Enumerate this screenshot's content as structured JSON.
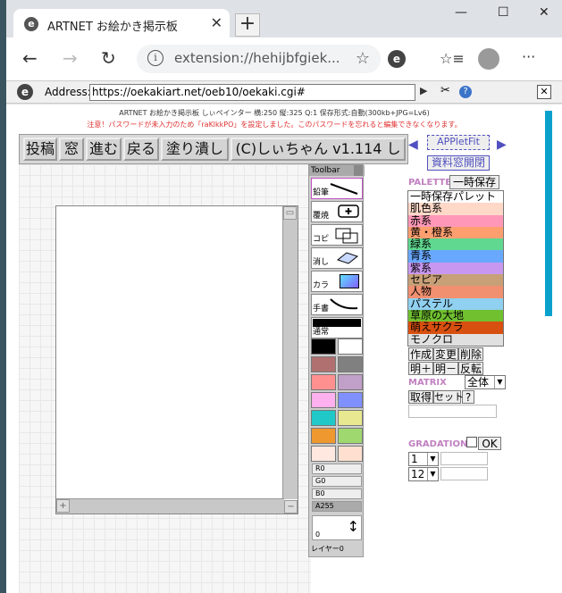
{
  "browser": {
    "tab_title": "ARTNET お絵かき掲示板",
    "tab_close": "✕",
    "new_tab": "+",
    "omnibox_url": "extension://hehijbfgiek...",
    "window_controls": {
      "minimize": "—",
      "maximize": "☐",
      "close": "✕"
    },
    "nav": {
      "back": "←",
      "forward": "→",
      "reload": "↻",
      "collections": "☆≡",
      "menu": "···"
    }
  },
  "ie_bar": {
    "label": "Address:",
    "url": "https://oekakiart.net/oeb10/oekaki.cgi#",
    "go": "▶",
    "tools": "✂",
    "help": "?",
    "close": "✕"
  },
  "page": {
    "header": "ARTNET お絵かき掲示板 しぃペインター 横:250 縦:325 Q:1 保存形式:自動(300kb+JPG=Lv6)",
    "warning": "注意！パスワードが未入力のため「raKlkkPO」を設定しました。このパスワードを忘れると編集できなくなります。"
  },
  "menu": [
    "投稿",
    "窓",
    "進む",
    "戻る",
    "塗り潰し",
    "(C)しぃちゃん v1.114 し"
  ],
  "toolbar": {
    "title": "Toolbar",
    "tools": [
      "鉛筆",
      "覆焼",
      "コピ",
      "消し",
      "カラ",
      "手書",
      "通常"
    ],
    "sliders": [
      "R0",
      "G0",
      "B0",
      "A255"
    ],
    "size_value": "0",
    "layer": "レイヤー0"
  },
  "swatches": [
    "#000000",
    "#ffffff",
    "#b07070",
    "#808080",
    "#ff9090",
    "#c0a0c8",
    "#ffb0ee",
    "#8090ff",
    "#20c8c8",
    "#e8e890",
    "#f09830",
    "#a0d870",
    "#ffe8e0",
    "#ffe0d0"
  ],
  "applet": {
    "fit_label": "APPletFit",
    "window_label": "資料窓開閉"
  },
  "palette": {
    "label": "PALETTE",
    "temp_save": "一時保存",
    "items": [
      {
        "name": "一時保存パレット",
        "color": "#ffffff"
      },
      {
        "name": "肌色系",
        "color": "#ffd8c8"
      },
      {
        "name": "赤系",
        "color": "#ff98b8"
      },
      {
        "name": "黄・橙系",
        "color": "#ff9f70"
      },
      {
        "name": "緑系",
        "color": "#60d890"
      },
      {
        "name": "青系",
        "color": "#68a8ff"
      },
      {
        "name": "紫系",
        "color": "#c898f0"
      },
      {
        "name": "セピア",
        "color": "#c8a078"
      },
      {
        "name": "人物",
        "color": "#f09070"
      },
      {
        "name": "パステル",
        "color": "#90d0f0"
      },
      {
        "name": "草原の大地",
        "color": "#70c030"
      },
      {
        "name": "萌えサクラ",
        "color": "#d85010"
      },
      {
        "name": "モノクロ",
        "color": "#e0e0e0"
      }
    ],
    "buttons1": [
      "作成",
      "変更",
      "削除"
    ],
    "buttons2": [
      "明＋",
      "明－",
      "反転"
    ]
  },
  "matrix": {
    "label": "MATRIX",
    "select": "全体",
    "buttons": [
      "取得",
      "セット",
      "?"
    ]
  },
  "gradation": {
    "label": "GRADATION",
    "ok": "OK",
    "select1": "1",
    "select2": "12"
  }
}
